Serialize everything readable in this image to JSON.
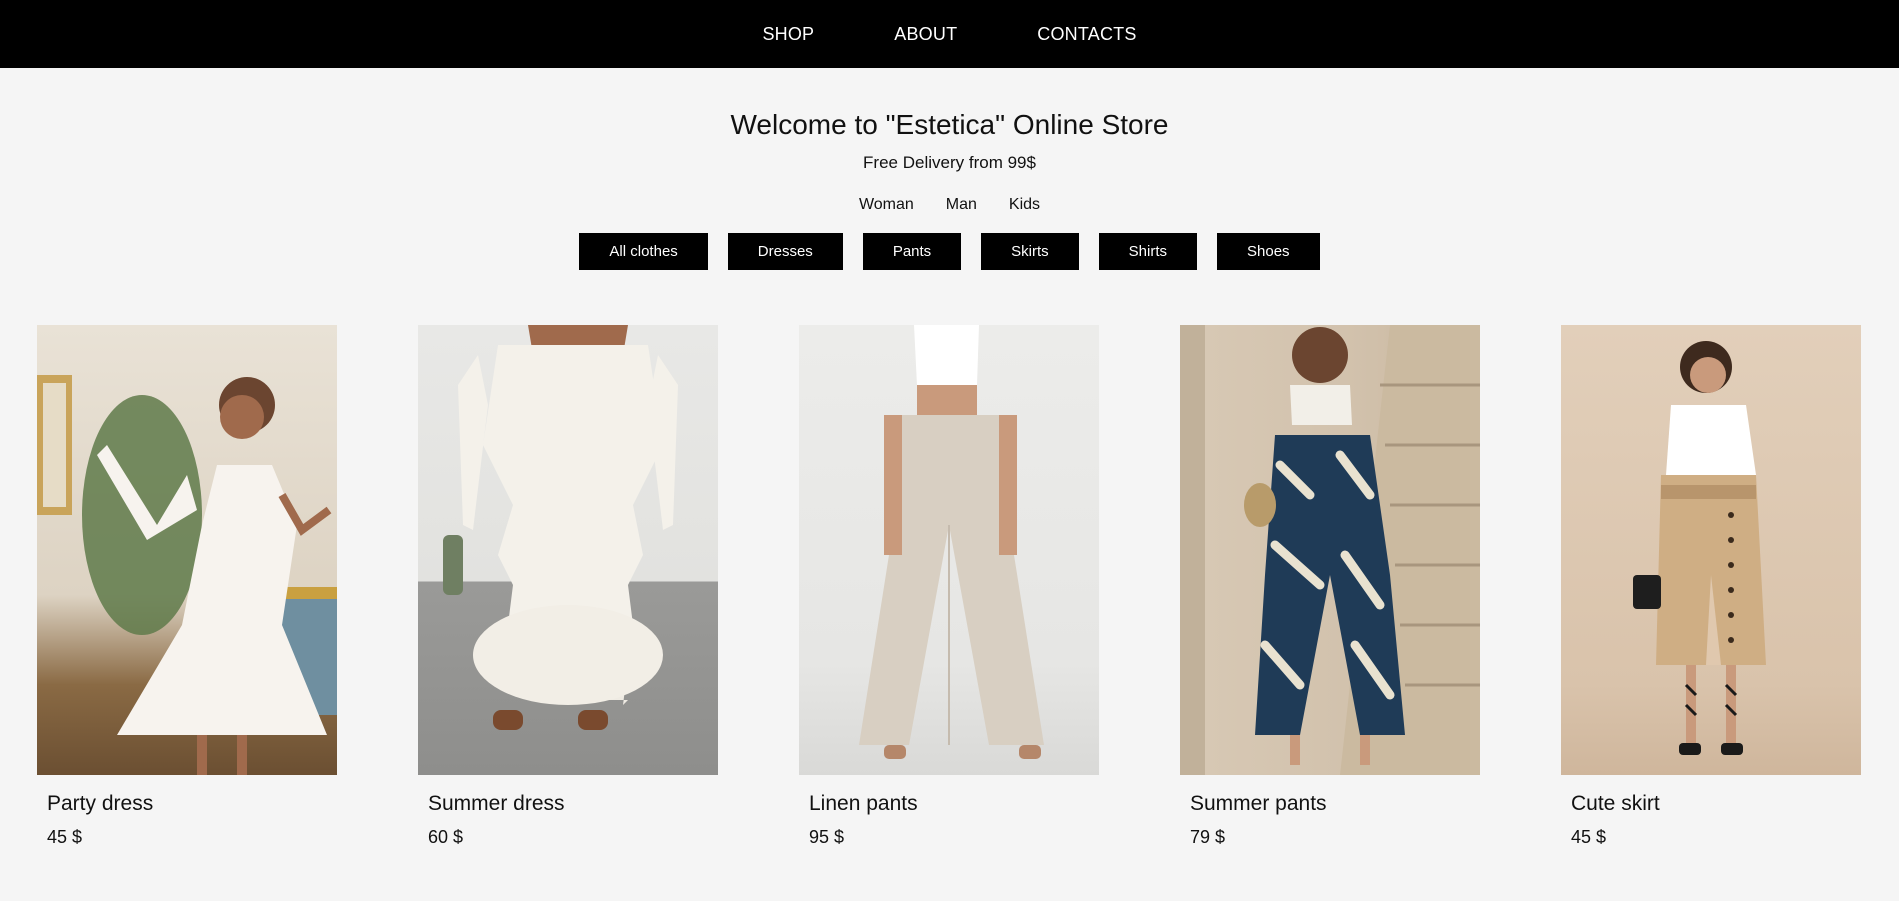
{
  "nav": {
    "shop": "SHOP",
    "about": "ABOUT",
    "contacts": "CONTACTS"
  },
  "hero": {
    "title": "Welcome to \"Estetica\" Online Store",
    "subtitle": "Free Delivery from 99$"
  },
  "gender": [
    "Woman",
    "Man",
    "Kids"
  ],
  "categories": [
    "All clothes",
    "Dresses",
    "Pants",
    "Skirts",
    "Shirts",
    "Shoes"
  ],
  "products": [
    {
      "name": "Party dress",
      "price": "45 $"
    },
    {
      "name": "Summer dress",
      "price": "60 $"
    },
    {
      "name": "Linen pants",
      "price": "95 $"
    },
    {
      "name": "Summer pants",
      "price": "79 $"
    },
    {
      "name": "Cute skirt",
      "price": "45 $"
    }
  ],
  "colors": {
    "nav_bg": "#000000",
    "page_bg": "#f5f5f5",
    "button_bg": "#000000",
    "button_text": "#ffffff"
  }
}
